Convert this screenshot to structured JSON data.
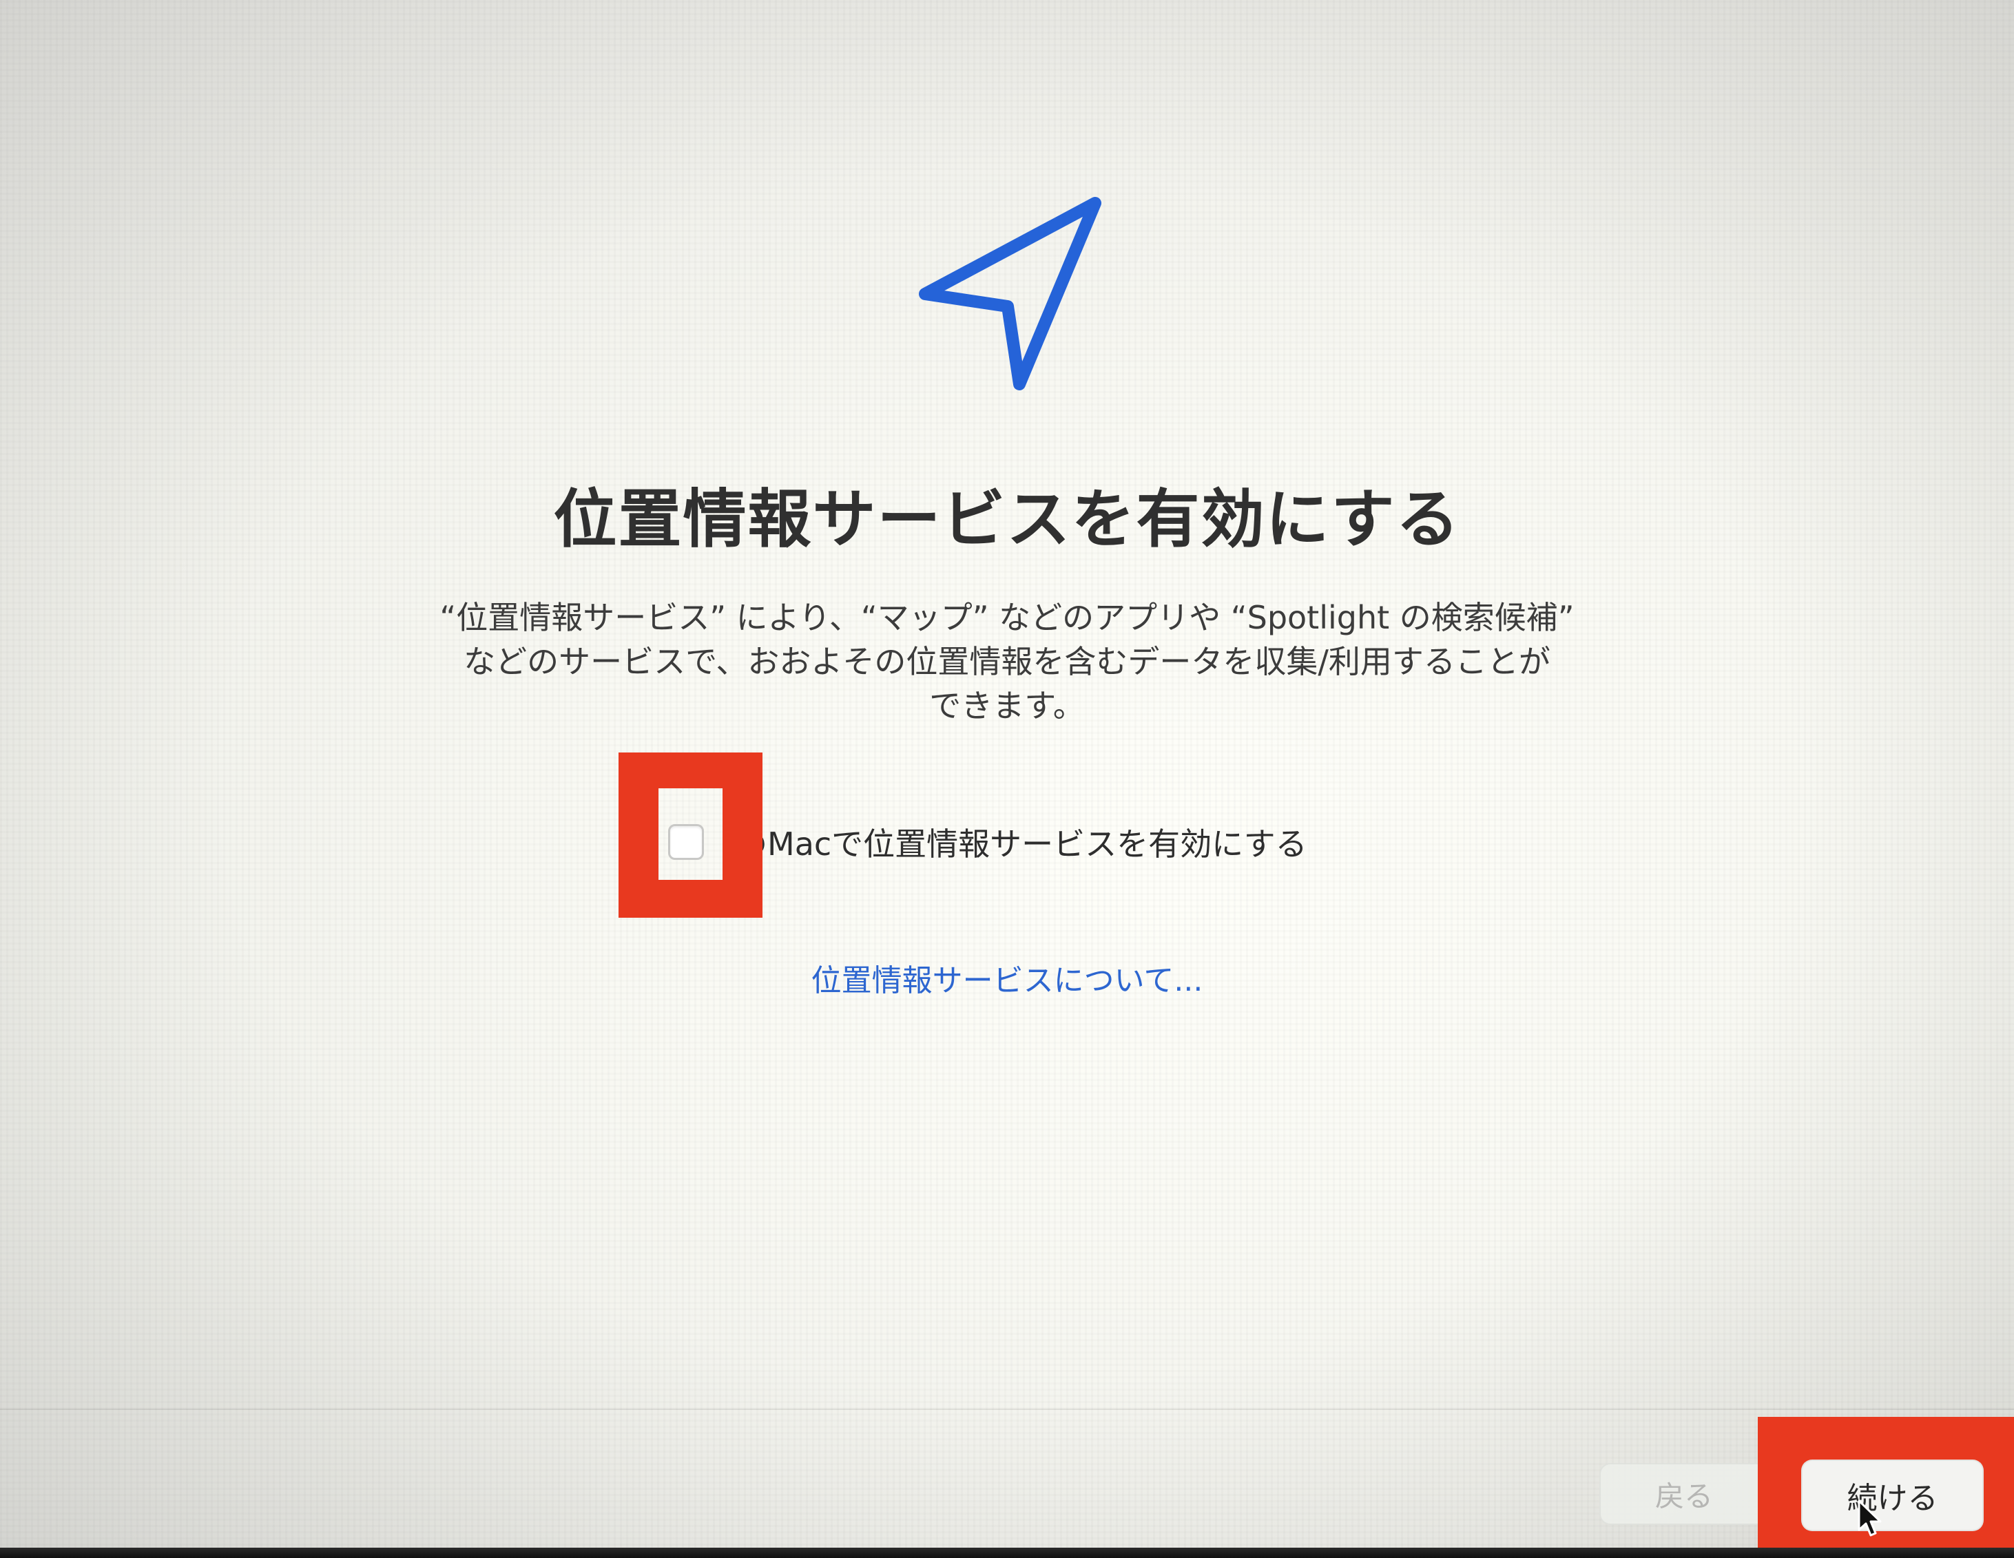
{
  "colors": {
    "accent": "#2d66d0",
    "icon_blue": "#2563d8",
    "highlight_red": "#e8391f"
  },
  "header": {
    "icon": "location-arrow-icon",
    "title": "位置情報サービスを有効にする"
  },
  "description": {
    "lines": [
      "“位置情報サービス” により、“マップ” などのアプリや “Spotlight の検索候補”",
      "などのサービスで、おおよその位置情報を含むデータを収集/利用することが",
      "できます。"
    ]
  },
  "checkbox": {
    "label": "のMacで位置情報サービスを有効にする",
    "checked": false
  },
  "link": {
    "about_label": "位置情報サービスについて..."
  },
  "footer": {
    "back_label": "戻る",
    "back_enabled": false,
    "continue_label": "続ける"
  },
  "annotations": {
    "highlighted_elements": [
      "checkbox",
      "continue-button"
    ]
  }
}
